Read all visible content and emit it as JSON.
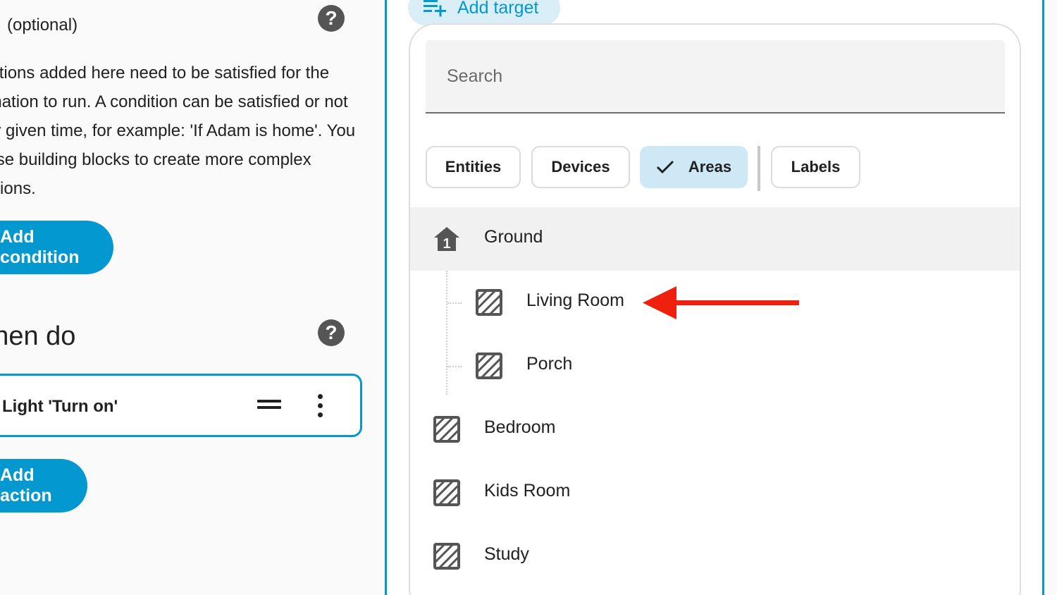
{
  "left_panel": {
    "optional_label": "(optional)",
    "help_icon_glyph": "?",
    "description": "tions added here need to be satisfied for the on to run. A condition can be satisfied or not ven time, for example: 'If Adam is home'. You building blocks to create more complex ns.",
    "description_lines": [
      "Conditions added here need to be satisfied for the",
      "automation to run. A condition can be satisfied or not",
      "at any given time, for example: 'If Adam is home'. You",
      "can use building blocks to create more complex",
      "conditions."
    ],
    "add_condition_label": "Add condition",
    "actions_title": "Then do",
    "action_card_text": "Light 'Turn on'",
    "add_action_label": "Add action"
  },
  "target_picker": {
    "add_target_label": "Add target",
    "search_placeholder": "Search",
    "filters": [
      {
        "label": "Entities",
        "selected": false
      },
      {
        "label": "Devices",
        "selected": false
      },
      {
        "label": "Areas",
        "selected": true
      },
      {
        "label": "Labels",
        "selected": false
      }
    ],
    "items": [
      {
        "label": "Ground",
        "icon": "floor-1-icon",
        "level": "floor",
        "highlighted": true
      },
      {
        "label": "Living Room",
        "icon": "area-hatched-icon",
        "level": "area-child",
        "highlighted": false
      },
      {
        "label": "Porch",
        "icon": "area-hatched-icon",
        "level": "area-child",
        "highlighted": false
      },
      {
        "label": "Bedroom",
        "icon": "area-hatched-icon",
        "level": "area",
        "highlighted": false
      },
      {
        "label": "Kids Room",
        "icon": "area-hatched-icon",
        "level": "area",
        "highlighted": false
      },
      {
        "label": "Study",
        "icon": "area-hatched-icon",
        "level": "area",
        "highlighted": false
      }
    ],
    "floor_number": "1"
  },
  "annotation": {
    "arrow_color": "#f0200f",
    "points_to": "Living Room"
  },
  "colors": {
    "accent": "#0398d0",
    "chip_selected_bg": "#cfe8f6",
    "highlight_row": "#f1f1f1"
  }
}
